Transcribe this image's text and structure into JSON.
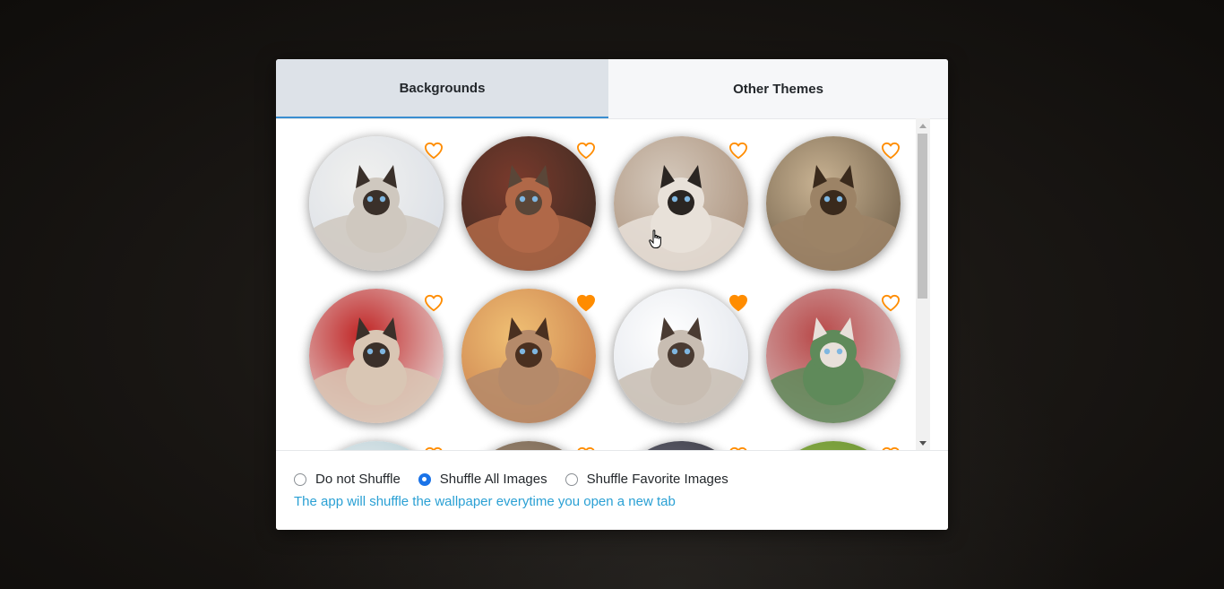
{
  "tabs": [
    {
      "label": "Backgrounds",
      "active": true
    },
    {
      "label": "Other Themes",
      "active": false
    }
  ],
  "gallery": {
    "items": [
      {
        "subject": "siamese-kitten-on-blanket",
        "favorite": false
      },
      {
        "subject": "dark-brown-cat-on-red-couch",
        "favorite": false
      },
      {
        "subject": "siamese-cat-with-cone-collar",
        "favorite": false
      },
      {
        "subject": "siamese-cat-in-suitcase",
        "favorite": false
      },
      {
        "subject": "siamese-cat-peeking-over-pillow",
        "favorite": false
      },
      {
        "subject": "cat-lying-in-warm-light",
        "favorite": true
      },
      {
        "subject": "siamese-cat-lying-on-table",
        "favorite": true
      },
      {
        "subject": "siamese-cat-on-checkered-floor",
        "favorite": false
      },
      {
        "subject": "partial-thumbnail-row-3-a",
        "favorite": false
      },
      {
        "subject": "partial-thumbnail-row-3-b",
        "favorite": false
      },
      {
        "subject": "partial-thumbnail-row-3-c",
        "favorite": false
      },
      {
        "subject": "partial-thumbnail-row-3-d",
        "favorite": false
      }
    ],
    "icon": "heart-icon"
  },
  "shuffle": {
    "options": [
      {
        "label": "Do not Shuffle",
        "checked": false
      },
      {
        "label": "Shuffle All Images",
        "checked": true
      },
      {
        "label": "Shuffle Favorite Images",
        "checked": false
      }
    ],
    "hint": "The app will shuffle the wallpaper everytime you open a new tab"
  },
  "colors": {
    "accent": "#ff8c00",
    "active_tab_bg": "#dde2e8",
    "hint_text": "#2aa0d4",
    "radio_checked": "#1a73e8"
  }
}
